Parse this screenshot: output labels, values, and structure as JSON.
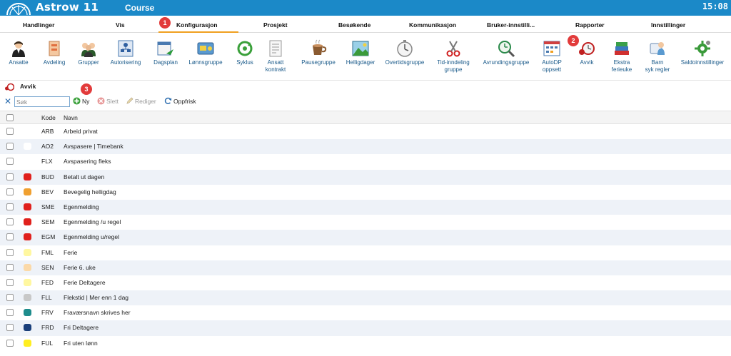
{
  "header": {
    "app_title": "Astrow 11",
    "course": "Course",
    "clock": "15:08",
    "color": "#1b89c8"
  },
  "menu": [
    {
      "label": "Handlinger"
    },
    {
      "label": "Vis"
    },
    {
      "label": "Konfigurasjon",
      "active": true
    },
    {
      "label": "Prosjekt"
    },
    {
      "label": "Besøkende"
    },
    {
      "label": "Kommunikasjon"
    },
    {
      "label": "Bruker-innstilli..."
    },
    {
      "label": "Rapporter"
    },
    {
      "label": "Innstillinger"
    }
  ],
  "badges": {
    "b1": "1",
    "b2": "2",
    "b3": "3"
  },
  "toolbar": [
    {
      "icon": "person-icon",
      "label": "Ansatte"
    },
    {
      "icon": "department-icon",
      "label": "Avdeling"
    },
    {
      "icon": "group-icon",
      "label": "Grupper"
    },
    {
      "icon": "authorization-icon",
      "label": "Autorisering"
    },
    {
      "icon": "dayplan-icon",
      "label": "Dagsplan"
    },
    {
      "icon": "salary-group-icon",
      "label": "Lønnsgruppe"
    },
    {
      "icon": "cycle-icon",
      "label": "Syklus"
    },
    {
      "icon": "contract-icon",
      "label": "Ansatt",
      "label2": "kontrakt"
    },
    {
      "icon": "coffee-icon",
      "label": "Pausegruppe"
    },
    {
      "icon": "holiday-icon",
      "label": "Helligdager"
    },
    {
      "icon": "overtime-icon",
      "label": "Overtidsgruppe"
    },
    {
      "icon": "scissors-icon",
      "label": "Tid-inndeling",
      "label2": "gruppe"
    },
    {
      "icon": "rounding-icon",
      "label": "Avrundingsgruppe"
    },
    {
      "icon": "autodp-icon",
      "label": "AutoDP",
      "label2": "oppsett"
    },
    {
      "icon": "deviation-icon",
      "label": "Avvik"
    },
    {
      "icon": "books-icon",
      "label": "Ekstra",
      "label2": "ferieuke"
    },
    {
      "icon": "child-sick-icon",
      "label": "Barn",
      "label2": "syk regler"
    },
    {
      "icon": "balance-settings-icon",
      "label": "Saldoinnstillinger"
    }
  ],
  "section": {
    "title": "Avvik"
  },
  "actions": {
    "search_placeholder": "Søk",
    "new_label": "Ny",
    "delete_label": "Slett",
    "edit_label": "Rediger",
    "refresh_label": "Oppfrisk"
  },
  "table": {
    "columns": {
      "code": "Kode",
      "name": "Navn"
    },
    "rows": [
      {
        "code": "ARB",
        "name": "Arbeid privat",
        "color": ""
      },
      {
        "code": "AO2",
        "name": "Avspasere | Timebank",
        "color": "#ffffff"
      },
      {
        "code": "FLX",
        "name": "Avspasering fleks",
        "color": ""
      },
      {
        "code": "BUD",
        "name": "Betalt ut dagen",
        "color": "#e0201c"
      },
      {
        "code": "BEV",
        "name": "Bevegelig helligdag",
        "color": "#f0a030"
      },
      {
        "code": "SME",
        "name": "Egenmelding",
        "color": "#e0201c"
      },
      {
        "code": "SEM",
        "name": "Egenmelding /u regel",
        "color": "#e0201c"
      },
      {
        "code": "EGM",
        "name": "Egenmelding u/regel",
        "color": "#e0201c"
      },
      {
        "code": "FML",
        "name": "Ferie",
        "color": "#fff7a0"
      },
      {
        "code": "SEN",
        "name": "Ferie 6. uke",
        "color": "#fbd9a8"
      },
      {
        "code": "FED",
        "name": "Ferie Deltagere",
        "color": "#fff7a0"
      },
      {
        "code": "FLL",
        "name": "Flekstid | Mer enn 1 dag",
        "color": "#c8c8c8"
      },
      {
        "code": "FRV",
        "name": "Fraværsnavn skrives her",
        "color": "#1e8c8c"
      },
      {
        "code": "FRD",
        "name": "Fri Deltagere",
        "color": "#1a3f7a"
      },
      {
        "code": "FUL",
        "name": "Fri uten lønn",
        "color": "#ffee20"
      }
    ]
  }
}
